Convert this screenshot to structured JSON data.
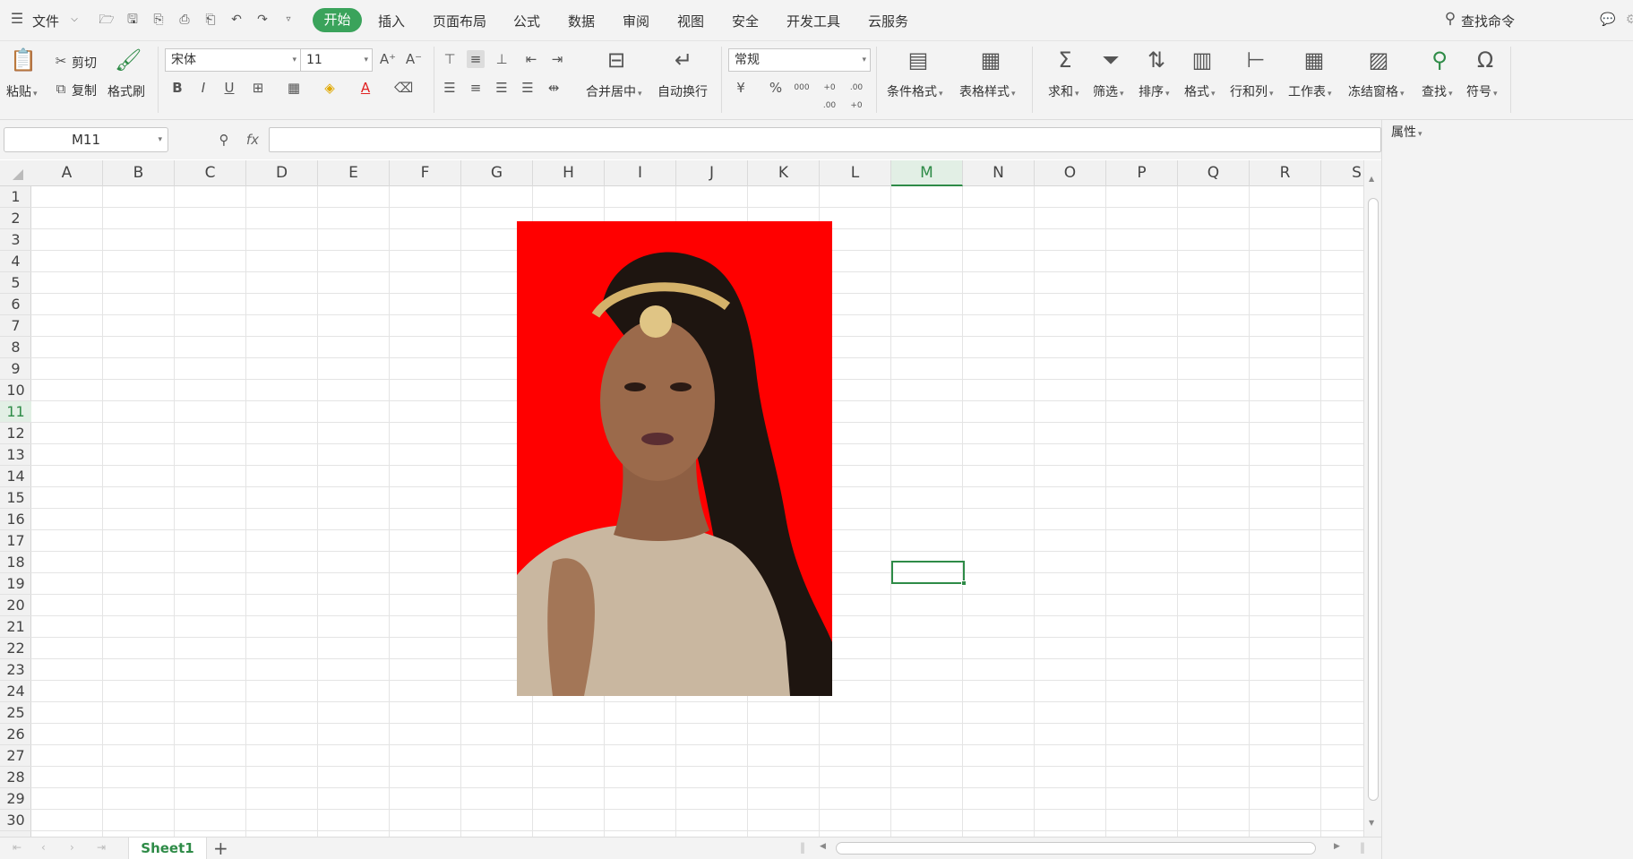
{
  "menubar": {
    "file_label": "文件",
    "tabs": [
      "开始",
      "插入",
      "页面布局",
      "公式",
      "数据",
      "审阅",
      "视图",
      "安全",
      "开发工具",
      "云服务"
    ],
    "search_label": "查找命令"
  },
  "ribbon": {
    "paste": "粘贴",
    "cut": "剪切",
    "copy": "复制",
    "format_painter": "格式刷",
    "font_name": "宋体",
    "font_size": "11",
    "bold": "B",
    "italic": "I",
    "underline": "U",
    "merge_center": "合并居中",
    "wrap_text": "自动换行",
    "number_format": "常规",
    "percent": "%",
    "thousands": "000",
    "inc_decimal": "+0 .00",
    "dec_decimal": ".00 +0",
    "conditional_format": "条件格式",
    "table_style": "表格样式",
    "sum": "求和",
    "filter": "筛选",
    "sort": "排序",
    "format": "格式",
    "row_col": "行和列",
    "worksheet": "工作表",
    "freeze": "冻结窗格",
    "find": "查找",
    "symbol": "符号"
  },
  "formula_bar": {
    "name_box": "M11",
    "fx_label": "fx",
    "formula_value": ""
  },
  "right_panel": {
    "properties_label": "属性"
  },
  "columns": [
    "A",
    "B",
    "C",
    "D",
    "E",
    "F",
    "G",
    "H",
    "I",
    "J",
    "K",
    "L",
    "M",
    "N",
    "O",
    "P",
    "Q",
    "R",
    "S"
  ],
  "rows": [
    "1",
    "2",
    "3",
    "4",
    "5",
    "6",
    "7",
    "8",
    "9",
    "10",
    "11",
    "12",
    "13",
    "14",
    "15",
    "16",
    "17",
    "18",
    "19",
    "20",
    "21",
    "22",
    "23",
    "24",
    "25",
    "26",
    "27",
    "28",
    "29",
    "30"
  ],
  "selected_column": "M",
  "selected_row": "11",
  "sheet_tab": "Sheet1",
  "add_sheet_label": "+",
  "image": {
    "background_color": "#ff0000"
  },
  "colors": {
    "accent": "#3aa35b",
    "selection": "#2e8b47"
  }
}
